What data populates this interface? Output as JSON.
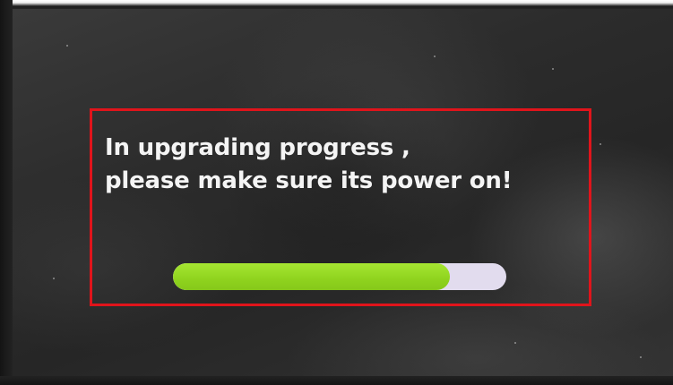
{
  "dialog": {
    "line1": "In upgrading progress ,",
    "line2": "please make sure its power on!"
  },
  "progress": {
    "fraction": 0.83,
    "fill_color": "#97d824",
    "track_color": "#e2dcee"
  },
  "colors": {
    "highlight_border": "#e0141b",
    "text": "#f4f4f4",
    "screen": "#2c2c2c"
  }
}
